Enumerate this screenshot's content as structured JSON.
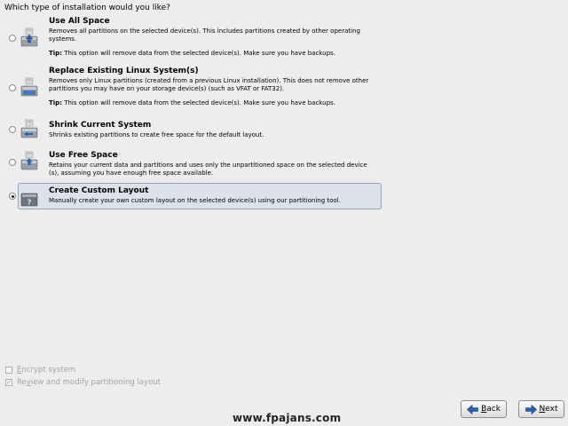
{
  "question": "Which type of installation would you like?",
  "options": [
    {
      "title": "Use All Space",
      "desc": "Removes all partitions on the selected device(s).  This includes partitions created by other operating systems.",
      "tip_label": "Tip:",
      "tip": " This option will remove data from the selected device(s).  Make sure you have backups.",
      "selected": false
    },
    {
      "title": "Replace Existing Linux System(s)",
      "desc": "Removes only Linux partitions (created from a previous Linux installation).  This does not remove other partitions you may have on your storage device(s) (such as VFAT or FAT32).",
      "tip_label": "Tip:",
      "tip": " This option will remove data from the selected device(s).  Make sure you have backups.",
      "selected": false
    },
    {
      "title": "Shrink Current System",
      "desc": "Shrinks existing partitions to create free space for the default layout.",
      "selected": false
    },
    {
      "title": "Use Free Space",
      "desc": "Retains your current data and partitions and uses only the unpartitioned space on the selected device (s), assuming you have enough free space available.",
      "selected": false
    },
    {
      "title": "Create Custom Layout",
      "desc": "Manually create your own custom layout on the selected device(s) using our partitioning tool.",
      "selected": true
    }
  ],
  "checkboxes": {
    "encrypt": {
      "pre": "",
      "ul": "E",
      "post": "ncrypt system",
      "checked": false
    },
    "review": {
      "pre": "Re",
      "ul": "v",
      "post": "iew and modify partitioning layout",
      "checked": true
    }
  },
  "watermark": "www.fpajans.com",
  "buttons": {
    "back": {
      "ul": "B",
      "rest": "ack"
    },
    "next": {
      "ul": "N",
      "rest": "ext"
    }
  },
  "colors": {
    "selected_bg": "#dde1ea",
    "arrow_blue": "#2f5fa8",
    "disabled_text": "#a3a3a3"
  }
}
